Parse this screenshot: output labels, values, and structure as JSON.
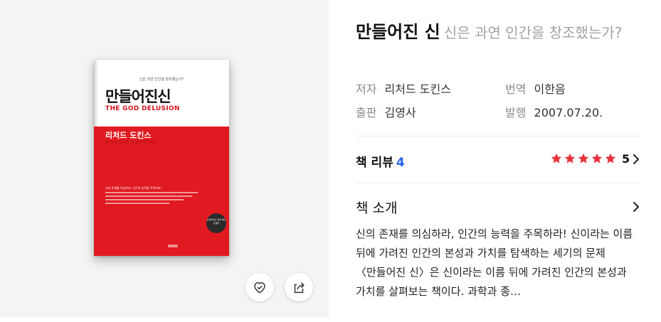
{
  "book": {
    "title": "만들어진 신",
    "subtitle": "신은 과연 인간을 창조했는가?",
    "author_label": "저자",
    "author": "리처드 도킨스",
    "translator_label": "번역",
    "translator": "이한음",
    "publisher_label": "출판",
    "publisher": "김영사",
    "date_label": "발행",
    "date": "2007.07.20."
  },
  "cover": {
    "tagline": "신은 과연 인간을 창조했는가?",
    "title_ko": "만들어진신",
    "title_en": "THE GOD DELUSION",
    "author_ko": "리처드 도킨스",
    "author_en": "RICHARD DAWKINS",
    "blurb": "신의 존재를 의심하라, 인간의 능력을 주목하라!",
    "badge": "뉴욕타임스 연속 베스트셀러",
    "colors": {
      "red": "#e01a20",
      "title_en": "#d4171e"
    }
  },
  "reviews": {
    "label": "책 리뷰",
    "count": "4",
    "rating": "5",
    "stars": 5,
    "star_color": "#e8333c"
  },
  "intro": {
    "label": "책 소개",
    "text": "신의 존재를 의심하라, 인간의 능력을 주목하라! 신이라는 이름 뒤에 가려진 인간의 본성과 가치를 탐색하는 세기의 문제 〈만들어진 신〉은 신이라는 이름 뒤에 가려진 인간의 본성과 가치를 살펴보는 책이다. 과학과 종…"
  },
  "icons": {
    "like": "heart-check-icon",
    "share": "share-icon",
    "chevron": "chevron-right-icon",
    "star": "star-icon"
  }
}
